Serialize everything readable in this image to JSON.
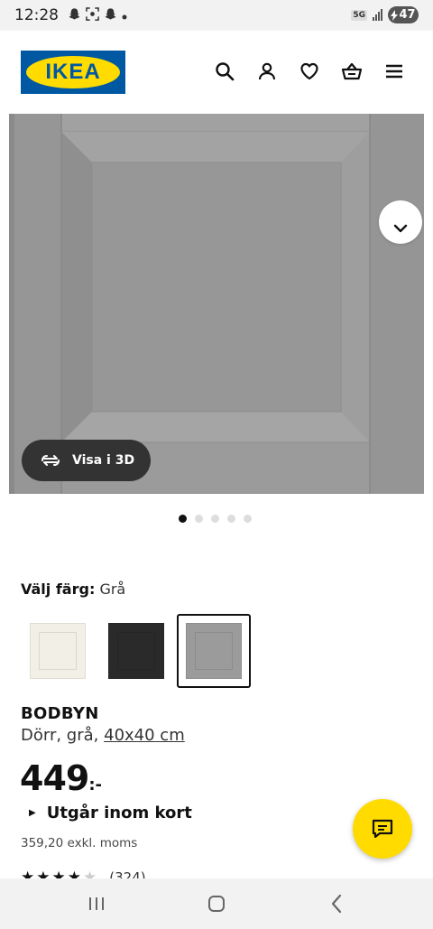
{
  "status_bar": {
    "time": "12:28",
    "network": "5G",
    "battery": "47",
    "left_icons": [
      "snapchat-icon",
      "screenshot-icon",
      "snapchat-icon",
      "dot-icon"
    ]
  },
  "header": {
    "logo_text": "IKEA",
    "icons": [
      "search-icon",
      "profile-icon",
      "heart-icon",
      "basket-icon",
      "menu-icon"
    ]
  },
  "hero": {
    "view3d_label": "Visa i 3D",
    "image_index": 1,
    "image_count": 5
  },
  "colors": {
    "label": "Välj färg:",
    "selected": "Grå",
    "swatches": [
      {
        "name": "white",
        "hex": "#f2f0e6"
      },
      {
        "name": "black",
        "hex": "#2a2a2a"
      },
      {
        "name": "grey",
        "hex": "#9b9b9b"
      }
    ],
    "selected_index": 2,
    "brand_blue": "#0058a3",
    "brand_yellow": "#ffdb00"
  },
  "product": {
    "name": "BODBYN",
    "description": "Dörr, grå,",
    "size": "40x40 cm",
    "price": "449",
    "price_suffix": ":-",
    "availability": "Utgår inom kort",
    "price_excl": "359,20 exkl. moms",
    "rating_stars": 4,
    "rating_max": 5,
    "rating_count": "(324)"
  }
}
